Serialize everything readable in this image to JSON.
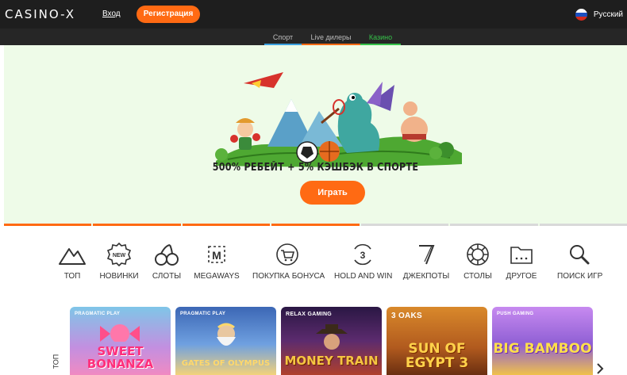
{
  "header": {
    "logo": "CASINO-X",
    "login_label": "Вход",
    "register_label": "Регистрация",
    "language": "Русский",
    "accent": "#ff6a13"
  },
  "subnav": {
    "tabs": [
      {
        "label": "Спорт",
        "color": "#3aa0e0"
      },
      {
        "label": "Live дилеры",
        "color": "#ff6a13"
      },
      {
        "label": "Казино",
        "color": "#36c24a"
      }
    ]
  },
  "hero": {
    "promo_text": "500% РЕБЕЙТ + 5% КЭШБЭК В СПОРТЕ",
    "play_label": "Играть",
    "active_slide": 4,
    "slide_count": 7
  },
  "categories": [
    {
      "label": "ТОП",
      "icon": "mountain-icon"
    },
    {
      "label": "НОВИНКИ",
      "icon": "new-badge-icon"
    },
    {
      "label": "СЛОТЫ",
      "icon": "cherries-icon"
    },
    {
      "label": "MEGAWAYS",
      "icon": "megaways-icon"
    },
    {
      "label": "ПОКУПКА БОНУСА",
      "icon": "cart-icon"
    },
    {
      "label": "HOLD AND WIN",
      "icon": "hold-and-win-icon"
    },
    {
      "label": "ДЖЕКПОТЫ",
      "icon": "seven-icon"
    },
    {
      "label": "СТОЛЫ",
      "icon": "chip-icon"
    },
    {
      "label": "ДРУГОЕ",
      "icon": "folder-icon"
    },
    {
      "label": "ПОИСК ИГР",
      "icon": "search-icon"
    }
  ],
  "side_label": "ТОП",
  "games": [
    {
      "provider": "PRAGMATIC PLAY",
      "title": "SWEET BONANZA"
    },
    {
      "provider": "PRAGMATIC PLAY",
      "title": "GATES OF OLYMPUS"
    },
    {
      "provider": "RELAX GAMING",
      "title": "MONEY TRAIN"
    },
    {
      "provider": "3 OAKS",
      "title": "SUN OF EGYPT 3"
    },
    {
      "provider": "PUSH GAMING",
      "title": "BIG BAMBOO"
    }
  ]
}
